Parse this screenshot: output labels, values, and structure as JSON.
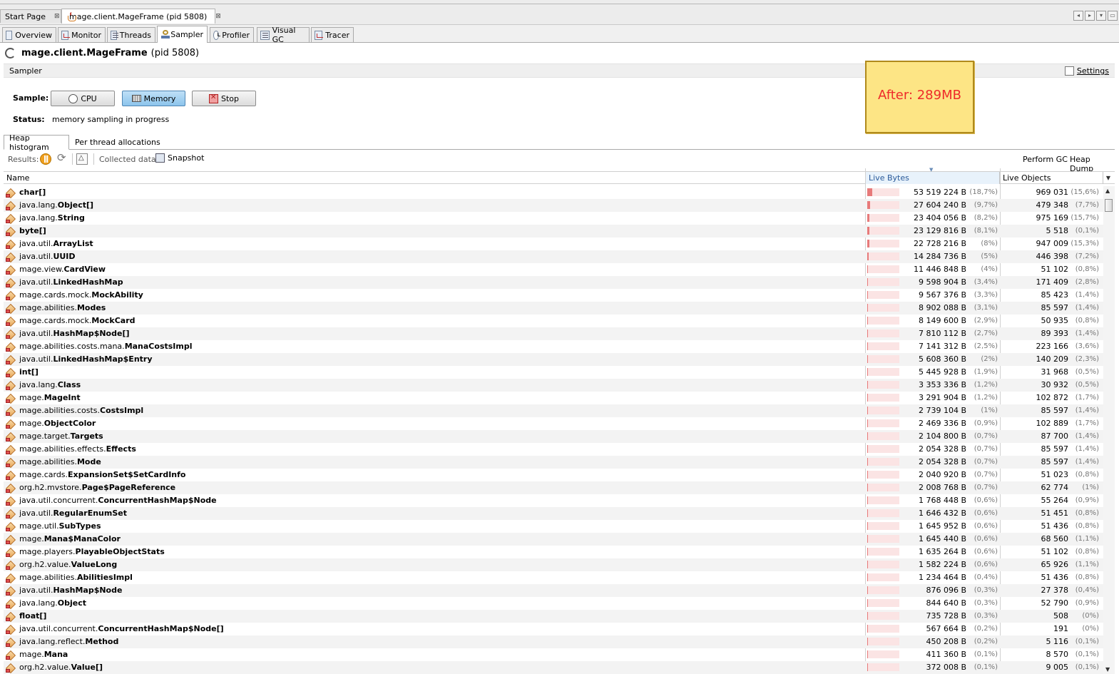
{
  "doc_tabs": [
    {
      "label": "Start Page",
      "close": "⊠"
    },
    {
      "label": "mage.client.MageFrame (pid 5808)",
      "close": "⊠"
    }
  ],
  "view_tabs": [
    "Overview",
    "Monitor",
    "Threads",
    "Sampler",
    "Profiler",
    "Visual GC",
    "Tracer"
  ],
  "view_tab_icons": [
    "overview-icon",
    "monitor-icon",
    "threads-icon",
    "sampler-icon",
    "profiler-icon",
    "visual-gc-icon",
    "tracer-icon"
  ],
  "title": {
    "app": "mage.client.MageFrame",
    "pid": "(pid 5808)"
  },
  "sampler": {
    "header": "Sampler",
    "settings": "Settings",
    "sample_label": "Sample:",
    "cpu": "CPU",
    "memory": "Memory",
    "stop": "Stop",
    "status_label": "Status:",
    "status": "memory sampling in progress"
  },
  "note": "After: 289MB",
  "sub_tabs": [
    "Heap histogram",
    "Per thread allocations"
  ],
  "results": {
    "label": "Results:",
    "collected": "Collected data:",
    "snapshot": "Snapshot",
    "perform_gc": "Perform GC",
    "heap_dump": "Heap Dump"
  },
  "columns": {
    "name": "Name",
    "live_bytes": "Live Bytes",
    "live_objects": "Live Objects"
  },
  "accent": "#e77a7a",
  "rows": [
    {
      "pkg": "",
      "cls": "char[]",
      "bytes": "53 519 224 B",
      "bpct": "(18,7%)",
      "objs": "969 031",
      "opct": "(15,6%)",
      "share": 0.187
    },
    {
      "pkg": "java.lang.",
      "cls": "Object[]",
      "bytes": "27 604 240 B",
      "bpct": "(9,7%)",
      "objs": "479 348",
      "opct": "(7,7%)",
      "share": 0.097
    },
    {
      "pkg": "java.lang.",
      "cls": "String",
      "bytes": "23 404 056 B",
      "bpct": "(8,2%)",
      "objs": "975 169",
      "opct": "(15,7%)",
      "share": 0.082
    },
    {
      "pkg": "",
      "cls": "byte[]",
      "bytes": "23 129 816 B",
      "bpct": "(8,1%)",
      "objs": "5 518",
      "opct": "(0,1%)",
      "share": 0.081
    },
    {
      "pkg": "java.util.",
      "cls": "ArrayList",
      "bytes": "22 728 216 B",
      "bpct": "(8%)",
      "objs": "947 009",
      "opct": "(15,3%)",
      "share": 0.08
    },
    {
      "pkg": "java.util.",
      "cls": "UUID",
      "bytes": "14 284 736 B",
      "bpct": "(5%)",
      "objs": "446 398",
      "opct": "(7,2%)",
      "share": 0.05
    },
    {
      "pkg": "mage.view.",
      "cls": "CardView",
      "bytes": "11 446 848 B",
      "bpct": "(4%)",
      "objs": "51 102",
      "opct": "(0,8%)",
      "share": 0.04
    },
    {
      "pkg": "java.util.",
      "cls": "LinkedHashMap",
      "bytes": "9 598 904 B",
      "bpct": "(3,4%)",
      "objs": "171 409",
      "opct": "(2,8%)",
      "share": 0.034
    },
    {
      "pkg": "mage.cards.mock.",
      "cls": "MockAbility",
      "bytes": "9 567 376 B",
      "bpct": "(3,3%)",
      "objs": "85 423",
      "opct": "(1,4%)",
      "share": 0.033
    },
    {
      "pkg": "mage.abilities.",
      "cls": "Modes",
      "bytes": "8 902 088 B",
      "bpct": "(3,1%)",
      "objs": "85 597",
      "opct": "(1,4%)",
      "share": 0.031
    },
    {
      "pkg": "mage.cards.mock.",
      "cls": "MockCard",
      "bytes": "8 149 600 B",
      "bpct": "(2,9%)",
      "objs": "50 935",
      "opct": "(0,8%)",
      "share": 0.029
    },
    {
      "pkg": "java.util.",
      "cls": "HashMap$Node[]",
      "bytes": "7 810 112 B",
      "bpct": "(2,7%)",
      "objs": "89 393",
      "opct": "(1,4%)",
      "share": 0.027
    },
    {
      "pkg": "mage.abilities.costs.mana.",
      "cls": "ManaCostsImpl",
      "bytes": "7 141 312 B",
      "bpct": "(2,5%)",
      "objs": "223 166",
      "opct": "(3,6%)",
      "share": 0.025
    },
    {
      "pkg": "java.util.",
      "cls": "LinkedHashMap$Entry",
      "bytes": "5 608 360 B",
      "bpct": "(2%)",
      "objs": "140 209",
      "opct": "(2,3%)",
      "share": 0.02
    },
    {
      "pkg": "",
      "cls": "int[]",
      "bytes": "5 445 928 B",
      "bpct": "(1,9%)",
      "objs": "31 968",
      "opct": "(0,5%)",
      "share": 0.019
    },
    {
      "pkg": "java.lang.",
      "cls": "Class",
      "bytes": "3 353 336 B",
      "bpct": "(1,2%)",
      "objs": "30 932",
      "opct": "(0,5%)",
      "share": 0.012
    },
    {
      "pkg": "mage.",
      "cls": "MageInt",
      "bytes": "3 291 904 B",
      "bpct": "(1,2%)",
      "objs": "102 872",
      "opct": "(1,7%)",
      "share": 0.012
    },
    {
      "pkg": "mage.abilities.costs.",
      "cls": "CostsImpl",
      "bytes": "2 739 104 B",
      "bpct": "(1%)",
      "objs": "85 597",
      "opct": "(1,4%)",
      "share": 0.01
    },
    {
      "pkg": "mage.",
      "cls": "ObjectColor",
      "bytes": "2 469 336 B",
      "bpct": "(0,9%)",
      "objs": "102 889",
      "opct": "(1,7%)",
      "share": 0.009
    },
    {
      "pkg": "mage.target.",
      "cls": "Targets",
      "bytes": "2 104 800 B",
      "bpct": "(0,7%)",
      "objs": "87 700",
      "opct": "(1,4%)",
      "share": 0.007
    },
    {
      "pkg": "mage.abilities.effects.",
      "cls": "Effects",
      "bytes": "2 054 328 B",
      "bpct": "(0,7%)",
      "objs": "85 597",
      "opct": "(1,4%)",
      "share": 0.007
    },
    {
      "pkg": "mage.abilities.",
      "cls": "Mode",
      "bytes": "2 054 328 B",
      "bpct": "(0,7%)",
      "objs": "85 597",
      "opct": "(1,4%)",
      "share": 0.007
    },
    {
      "pkg": "mage.cards.",
      "cls": "ExpansionSet$SetCardInfo",
      "bytes": "2 040 920 B",
      "bpct": "(0,7%)",
      "objs": "51 023",
      "opct": "(0,8%)",
      "share": 0.007
    },
    {
      "pkg": "org.h2.mvstore.",
      "cls": "Page$PageReference",
      "bytes": "2 008 768 B",
      "bpct": "(0,7%)",
      "objs": "62 774",
      "opct": "(1%)",
      "share": 0.007
    },
    {
      "pkg": "java.util.concurrent.",
      "cls": "ConcurrentHashMap$Node",
      "bytes": "1 768 448 B",
      "bpct": "(0,6%)",
      "objs": "55 264",
      "opct": "(0,9%)",
      "share": 0.006
    },
    {
      "pkg": "java.util.",
      "cls": "RegularEnumSet",
      "bytes": "1 646 432 B",
      "bpct": "(0,6%)",
      "objs": "51 451",
      "opct": "(0,8%)",
      "share": 0.006
    },
    {
      "pkg": "mage.util.",
      "cls": "SubTypes",
      "bytes": "1 645 952 B",
      "bpct": "(0,6%)",
      "objs": "51 436",
      "opct": "(0,8%)",
      "share": 0.006
    },
    {
      "pkg": "mage.",
      "cls": "Mana$ManaColor",
      "bytes": "1 645 440 B",
      "bpct": "(0,6%)",
      "objs": "68 560",
      "opct": "(1,1%)",
      "share": 0.006
    },
    {
      "pkg": "mage.players.",
      "cls": "PlayableObjectStats",
      "bytes": "1 635 264 B",
      "bpct": "(0,6%)",
      "objs": "51 102",
      "opct": "(0,8%)",
      "share": 0.006
    },
    {
      "pkg": "org.h2.value.",
      "cls": "ValueLong",
      "bytes": "1 582 224 B",
      "bpct": "(0,6%)",
      "objs": "65 926",
      "opct": "(1,1%)",
      "share": 0.006
    },
    {
      "pkg": "mage.abilities.",
      "cls": "AbilitiesImpl",
      "bytes": "1 234 464 B",
      "bpct": "(0,4%)",
      "objs": "51 436",
      "opct": "(0,8%)",
      "share": 0.004
    },
    {
      "pkg": "java.util.",
      "cls": "HashMap$Node",
      "bytes": "876 096 B",
      "bpct": "(0,3%)",
      "objs": "27 378",
      "opct": "(0,4%)",
      "share": 0.003
    },
    {
      "pkg": "java.lang.",
      "cls": "Object",
      "bytes": "844 640 B",
      "bpct": "(0,3%)",
      "objs": "52 790",
      "opct": "(0,9%)",
      "share": 0.003
    },
    {
      "pkg": "",
      "cls": "float[]",
      "bytes": "735 728 B",
      "bpct": "(0,3%)",
      "objs": "508",
      "opct": "(0%)",
      "share": 0.003
    },
    {
      "pkg": "java.util.concurrent.",
      "cls": "ConcurrentHashMap$Node[]",
      "bytes": "567 664 B",
      "bpct": "(0,2%)",
      "objs": "191",
      "opct": "(0%)",
      "share": 0.002
    },
    {
      "pkg": "java.lang.reflect.",
      "cls": "Method",
      "bytes": "450 208 B",
      "bpct": "(0,2%)",
      "objs": "5 116",
      "opct": "(0,1%)",
      "share": 0.002
    },
    {
      "pkg": "mage.",
      "cls": "Mana",
      "bytes": "411 360 B",
      "bpct": "(0,1%)",
      "objs": "8 570",
      "opct": "(0,1%)",
      "share": 0.001
    },
    {
      "pkg": "org.h2.value.",
      "cls": "Value[]",
      "bytes": "372 008 B",
      "bpct": "(0,1%)",
      "objs": "9 005",
      "opct": "(0,1%)",
      "share": 0.001
    }
  ]
}
